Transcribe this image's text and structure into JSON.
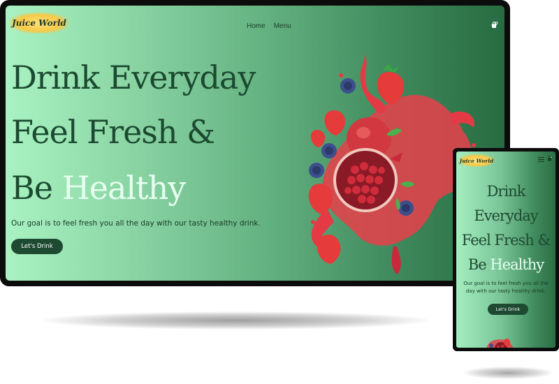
{
  "brand": {
    "logo_text": "Juice World"
  },
  "nav": {
    "home": "Home",
    "menu": "Menu"
  },
  "hero": {
    "line1": "Drink Everyday",
    "line2": "Feel Fresh &",
    "line3_prefix": "Be ",
    "line3_accent": "Healthy",
    "tagline": "Our goal is to feel fresh you all the day with our tasty healthy drink.",
    "cta": "Let's Drink"
  },
  "mobile": {
    "line1": "Drink",
    "line2": "Everyday",
    "line3": "Feel Fresh &",
    "line4_prefix": "Be ",
    "line4_accent": "Healthy",
    "tagline": "Our goal is to feel fresh you all the day with our tasty healthy drink.",
    "cta": "Let's Drink"
  },
  "icons": {
    "cart": "cart-icon",
    "menu": "hamburger-icon",
    "hero_image": "pomegranate-splash"
  },
  "colors": {
    "accent": "#1e4a32",
    "headline": "#1b4a30",
    "highlight": "#e6fff0",
    "logo": "#f7c948"
  }
}
